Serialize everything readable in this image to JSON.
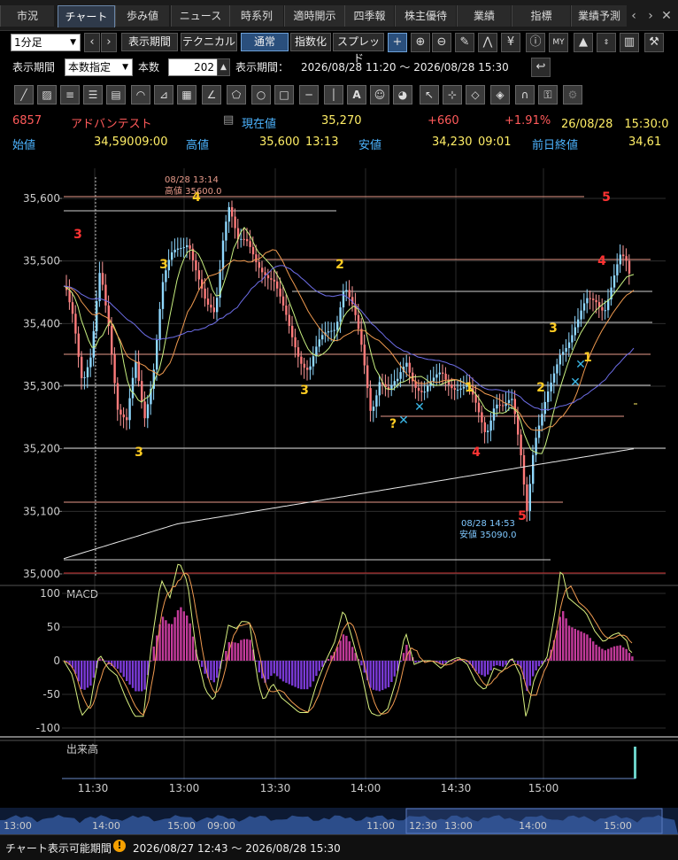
{
  "tabs": [
    "市況",
    "チャート",
    "歩み値",
    "ニュース",
    "時系列",
    "適時開示",
    "四季報",
    "株主優待",
    "業績",
    "指標",
    "業績予測"
  ],
  "active_tab": 1,
  "toolbar": {
    "interval": "1分足",
    "display_period_btn": "表示期間",
    "technical_btn": "テクニカル",
    "normal_btn": "通常",
    "index_btn": "指数化",
    "spread_btn": "スプレッド",
    "period_label": "表示期間",
    "period_mode": "本数指定",
    "count_label": "本数",
    "count_value": "202",
    "range_label": "表示期間：",
    "range_value": "2026/08/28 11:20 ～ 2026/08/28 15:30"
  },
  "quote": {
    "code": "6857",
    "name": "アドバンテスト",
    "current_label": "現在値",
    "current": "35,270",
    "change": "+660",
    "change_pct": "+1.91%",
    "datetime": "26/08/28　15:30:0",
    "open_label": "始値",
    "open": "34,590",
    "open_time": "09:00",
    "high_label": "高値",
    "high": "35,600",
    "high_time": "13:13",
    "low_label": "安値",
    "low": "34,230",
    "low_time": "09:01",
    "prev_label": "前日終値",
    "prev": "34,61"
  },
  "chart_data": {
    "type": "candlestick",
    "y_ticks": [
      "35,600",
      "35,500",
      "35,400",
      "35,300",
      "35,200",
      "35,100",
      "35,000"
    ],
    "ylim": [
      34990,
      35640
    ],
    "x_ticks": [
      "11:30",
      "13:00",
      "13:30",
      "14:00",
      "14:30",
      "15:00"
    ],
    "high_note": {
      "line1": "08/28 13:14",
      "line2": "高値 35600.0"
    },
    "low_note": {
      "line1": "08/28 14:53",
      "line2": "安値 35090.0"
    },
    "wave_labels": [
      {
        "t": "3",
        "c": "#ff3333"
      },
      {
        "t": "3",
        "c": "#ffcc22"
      },
      {
        "t": "4",
        "c": "#ffcc22"
      },
      {
        "t": "3",
        "c": "#ffcc22"
      },
      {
        "t": "3",
        "c": "#ffcc22"
      },
      {
        "t": "2",
        "c": "#ffcc22"
      },
      {
        "t": "?",
        "c": "#ffcc22"
      },
      {
        "t": "1",
        "c": "#ffcc22"
      },
      {
        "t": "4",
        "c": "#ff3333"
      },
      {
        "t": "5",
        "c": "#ff3333"
      },
      {
        "t": "2",
        "c": "#ffcc22"
      },
      {
        "t": "3",
        "c": "#ffcc22"
      },
      {
        "t": "1",
        "c": "#ffcc22"
      },
      {
        "t": "4",
        "c": "#ff3333"
      },
      {
        "t": "5",
        "c": "#ff3333"
      }
    ],
    "macd": {
      "label": "MACD",
      "y_ticks": [
        "100",
        "50",
        "0",
        "-50",
        "-100"
      ]
    },
    "volume": {
      "label": "出来高"
    }
  },
  "nav_ticks": [
    "13:00",
    "14:00",
    "15:00",
    "09:00",
    "11:00",
    "12:30",
    "13:00",
    "14:00",
    "15:00"
  ],
  "status": {
    "label": "チャート表示可能期間",
    "range": "2026/08/27 12:43 ～ 2026/08/28 15:30"
  }
}
